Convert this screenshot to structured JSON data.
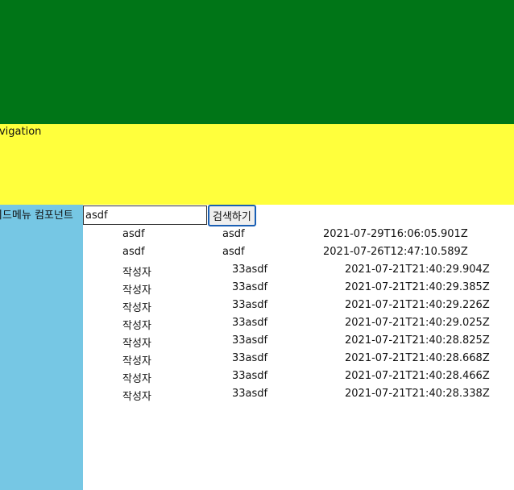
{
  "nav": {
    "label": "avigation"
  },
  "sidebar": {
    "label": "이드메뉴 컴포넌트"
  },
  "search": {
    "value": "asdf",
    "button_label": "검색하기"
  },
  "rows": [
    {
      "writer": "asdf",
      "content": "asdf",
      "date": "2021-07-29T16:06:05.901Z"
    },
    {
      "writer": "asdf",
      "content": "asdf",
      "date": "2021-07-26T12:47:10.589Z"
    },
    {
      "writer": "작성자",
      "content": "33asdf",
      "date": "2021-07-21T21:40:29.904Z"
    },
    {
      "writer": "작성자",
      "content": "33asdf",
      "date": "2021-07-21T21:40:29.385Z"
    },
    {
      "writer": "작성자",
      "content": "33asdf",
      "date": "2021-07-21T21:40:29.226Z"
    },
    {
      "writer": "작성자",
      "content": "33asdf",
      "date": "2021-07-21T21:40:29.025Z"
    },
    {
      "writer": "작성자",
      "content": "33asdf",
      "date": "2021-07-21T21:40:28.825Z"
    },
    {
      "writer": "작성자",
      "content": "33asdf",
      "date": "2021-07-21T21:40:28.668Z"
    },
    {
      "writer": "작성자",
      "content": "33asdf",
      "date": "2021-07-21T21:40:28.466Z"
    },
    {
      "writer": "작성자",
      "content": "33asdf",
      "date": "2021-07-21T21:40:28.338Z"
    }
  ]
}
